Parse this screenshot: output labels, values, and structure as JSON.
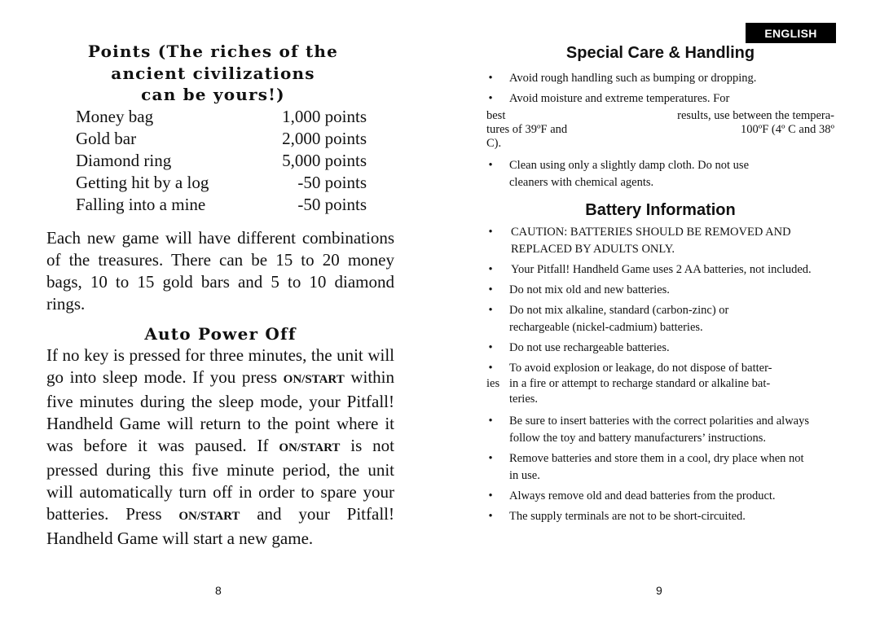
{
  "left_page": {
    "points_heading": "Points (The riches of the ancient civilizations can be yours!)",
    "points_heading_lines": [
      "Points (The riches of the",
      "ancient civilizations",
      "can be yours!)"
    ],
    "points_table": [
      {
        "item": "Money bag",
        "points": "1,000 points"
      },
      {
        "item": "Gold bar",
        "points": "2,000 points"
      },
      {
        "item": "Diamond ring",
        "points": "5,000 points"
      },
      {
        "item": "Getting hit by a log",
        "points": "-50 points"
      },
      {
        "item": "Falling into a mine",
        "points": "-50 points"
      }
    ],
    "combinations_paragraph": "Each new game will have different combinations of the treasures. There can be 15 to 20 money bags, 10 to 15 gold bars and 5 to 10 diamond rings.",
    "auto_power_off_heading": "Auto Power Off",
    "auto_power_off_segments": {
      "s1": "If no key is pressed for three minutes, the unit will go into sleep mode. If you press ",
      "key1": "ON/START",
      "s2": " within five minutes during the sleep mode, your Pitfall! Handheld Game will return to the point where it was before it was paused. If ",
      "key2": "ON/START",
      "s3": " is not pressed during this five minute period, the unit will automatically turn off in order to spare your batteries. Press ",
      "key3": "ON/START",
      "s4": " and your Pitfall! Handheld Game will start a new game."
    },
    "page_number": "8"
  },
  "right_page": {
    "language_badge": "ENGLISH",
    "care_heading": "Special Care & Handling",
    "care_items": [
      "Avoid rough handling such as bumping or dropping.",
      "Avoid moisture and extreme temperatures. For",
      "Clean using only a slightly damp cloth. Do not use cleaners with chemical agents."
    ],
    "care_temp_lines": [
      {
        "left": "best",
        "right": "results, use between the tempera-"
      },
      {
        "left": "tures of 39ºF and",
        "right": "100ºF (4º C and 38º"
      },
      {
        "left": "C).",
        "right": ""
      }
    ],
    "battery_heading": "Battery Information",
    "battery_items": [
      "CAUTION: BATTERIES SHOULD BE REMOVED AND REPLACED BY ADULTS ONLY.",
      "Your Pitfall! Handheld Game uses 2 AA batteries, not included.",
      "Do not mix old and new batteries.",
      "Do not mix alkaline, standard (carbon-zinc) or rechargeable (nickel-cadmium) batteries.",
      "Do not use rechargeable batteries.",
      "To avoid explosion or leakage, do not dispose of batteries in a fire or attempt to recharge standard or alkaline batteries.",
      "Be sure to insert batteries with the correct polarities and always follow the toy and battery manufacturers’ instructions.",
      "Remove batteries and store them in a cool, dry place when not in use.",
      "Always remove old and dead batteries from the product.",
      "The supply terminals are not to be short-circuited."
    ],
    "explode_lines": {
      "l1": "To avoid explosion or leakage, do not dispose of batter-",
      "l2_prefix": "ies",
      "l2": "in a fire or attempt to recharge standard or alkaline bat-",
      "l3": "teries."
    },
    "page_number": "9",
    "bullet_glyph": "•"
  }
}
